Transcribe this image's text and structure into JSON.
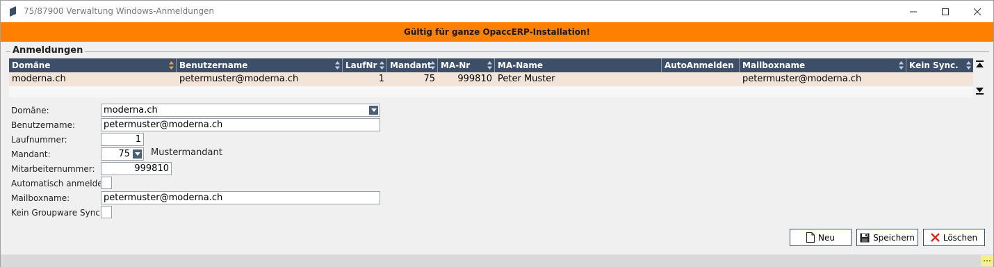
{
  "window": {
    "title": "75/87900 Verwaltung Windows-Anmeldungen",
    "icons": {
      "app": "app-logo-icon",
      "minimize": "minimize-icon",
      "maximize": "maximize-icon",
      "close": "close-icon"
    }
  },
  "banner": {
    "text": "Gültig für ganze OpaccERP-Installation!",
    "color": "#ff8000"
  },
  "group": {
    "title": "Anmeldungen"
  },
  "grid": {
    "columns": [
      "Domäne",
      "Benutzername",
      "LaufNr",
      "Mandant",
      "MA-Nr",
      "MA-Name",
      "AutoAnmelden",
      "Mailboxname",
      "Kein Sync."
    ],
    "rows": [
      {
        "domaene": "moderna.ch",
        "benutzername": "petermuster@moderna.ch",
        "laufnr": "1",
        "mandant": "75",
        "manr": "999810",
        "maname": "Peter Muster",
        "autoanmelden": "",
        "mailboxname": "petermuster@moderna.ch",
        "keinsync": ""
      }
    ],
    "header_color": "#3c4e68",
    "selected_row_color": "#f2e4d8"
  },
  "form": {
    "domaene": {
      "label": "Domäne:",
      "value": "moderna.ch"
    },
    "benutzername": {
      "label": "Benutzername:",
      "value": "petermuster@moderna.ch"
    },
    "laufnummer": {
      "label": "Laufnummer:",
      "value": "1"
    },
    "mandant": {
      "label": "Mandant:",
      "value": "75",
      "name": "Mustermandant"
    },
    "mitarbeiternummer": {
      "label": "Mitarbeiternummer:",
      "value": "999810"
    },
    "automatisch": {
      "label": "Automatisch anmelden:",
      "checked": false
    },
    "mailboxname": {
      "label": "Mailboxname:",
      "value": "petermuster@moderna.ch"
    },
    "kein_sync": {
      "label": "Kein Groupware Sync.:",
      "checked": false
    }
  },
  "buttons": {
    "neu": {
      "label": "Neu",
      "icon": "new-document-icon"
    },
    "speichern": {
      "label": "Speichern",
      "icon": "save-disk-icon"
    },
    "loeschen": {
      "label": "Löschen",
      "icon": "delete-x-icon"
    }
  }
}
